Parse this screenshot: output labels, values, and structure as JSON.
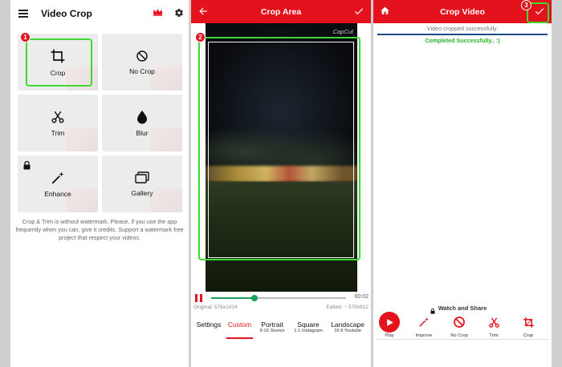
{
  "panel1": {
    "title": "Video Crop",
    "tiles": {
      "crop": "Crop",
      "no_crop": "No Crop",
      "trim": "Trim",
      "blur": "Blur",
      "enhance": "Enhance",
      "gallery": "Gallery"
    },
    "info_text": "Crop & Trim is without watermark. Please, if you use the app frequently when you can, give it credits. Support a watermark free project that respect your videos.",
    "step_badge": "1"
  },
  "panel2": {
    "title": "Crop Area",
    "watermark": "CapCut",
    "step_badge": "2",
    "playback": {
      "end_time": "00:02",
      "progress": 0.32
    },
    "original_dims": "Original: 576x1024",
    "edited_dims": "Edited: ~ 576x812",
    "tabs": [
      {
        "label": "Settings",
        "sub": ""
      },
      {
        "label": "Custom",
        "sub": ""
      },
      {
        "label": "Portrait",
        "sub": "9:16 Stories"
      },
      {
        "label": "Square",
        "sub": "1:1 Instagram"
      },
      {
        "label": "Landscape",
        "sub": "16:9 Youtube"
      }
    ]
  },
  "panel3": {
    "title": "Crop Video",
    "step_badge": "3",
    "message": "Video cropped successfully.",
    "success": "Completed Successfully.. :)",
    "watch_share": "Watch and Share",
    "actions": {
      "play": "Play",
      "improve": "Improve",
      "no_crop": "No Crop",
      "trim": "Trim",
      "crop": "Crop"
    }
  },
  "colors": {
    "accent_red": "#e3121c",
    "highlight_green": "#3ed832",
    "success_green": "#2bb02b",
    "progress_green": "#18a056"
  }
}
